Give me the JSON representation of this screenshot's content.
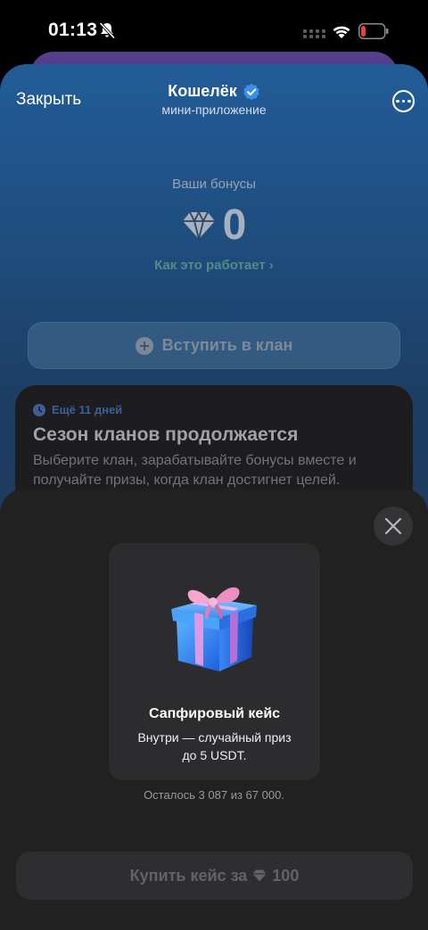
{
  "status_bar": {
    "time": "01:13",
    "icons": [
      "bell-slash-icon",
      "cellular-signal-icon",
      "wifi-icon",
      "battery-low-icon"
    ],
    "battery_color": "#e5443a"
  },
  "header": {
    "close_label": "Закрыть",
    "title": "Кошелёк",
    "subtitle": "мини-приложение",
    "verified_icon": "verified-badge-icon",
    "more_icon": "more-horizontal-icon"
  },
  "bonus": {
    "label": "Ваши бонусы",
    "value": "0",
    "icon": "diamond-icon",
    "how_it_works": "Как это работает",
    "how_it_works_chevron": "›"
  },
  "join_button": {
    "label": "Вступить в клан",
    "icon": "plus-circle-icon"
  },
  "season_card": {
    "badge": "Ещё 11 дней",
    "title": "Сезон кланов продолжается",
    "description": "Выберите клан, зарабатывайте бонусы вместе и получайте призы, когда клан достигнет целей."
  },
  "modal": {
    "close_icon": "close-icon",
    "case": {
      "icon": "gift-box-icon",
      "title": "Сапфировый кейс",
      "description_line1": "Внутри — случайный приз",
      "description_line2": "до 5 USDT."
    },
    "remaining": "Осталось 3 087 из 67 000.",
    "buy_button": {
      "label": "Купить кейс за",
      "price": "100",
      "icon": "diamond-icon"
    }
  },
  "colors": {
    "accent_link": "#4f8d86",
    "badge": "#3d5f9a",
    "verified": "#3a8ff0"
  }
}
